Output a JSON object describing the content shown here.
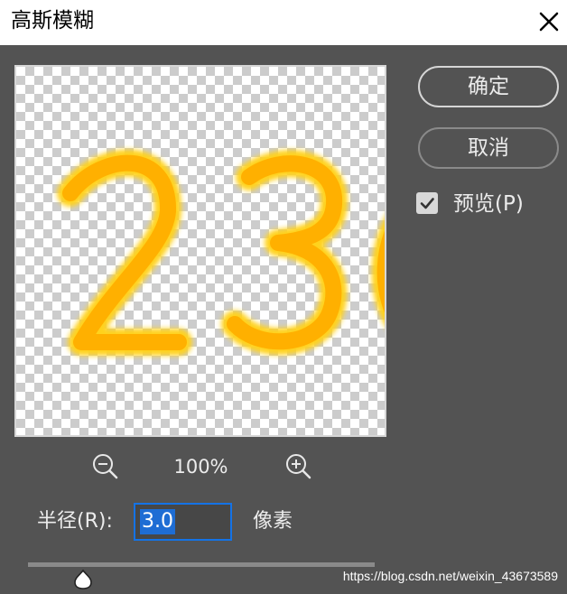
{
  "window": {
    "title": "高斯模糊"
  },
  "buttons": {
    "ok": "确定",
    "cancel": "取消"
  },
  "preview_option": {
    "label": "预览(P)",
    "checked": true
  },
  "zoom": {
    "level": "100%"
  },
  "radius": {
    "label": "半径(R):",
    "value": "3.0",
    "unit": "像素",
    "slider_fraction": 0.16
  },
  "canvas": {
    "text": "23",
    "stroke_color": "#ffb000",
    "glow_color": "#ffd21f"
  },
  "watermark": "https://blog.csdn.net/weixin_43673589",
  "colors": {
    "dialog_bg": "#535353",
    "accent": "#1473e6"
  },
  "icons": [
    "close-icon",
    "checkbox-checked-icon",
    "zoom-out-icon",
    "zoom-in-icon",
    "slider-thumb-icon"
  ]
}
